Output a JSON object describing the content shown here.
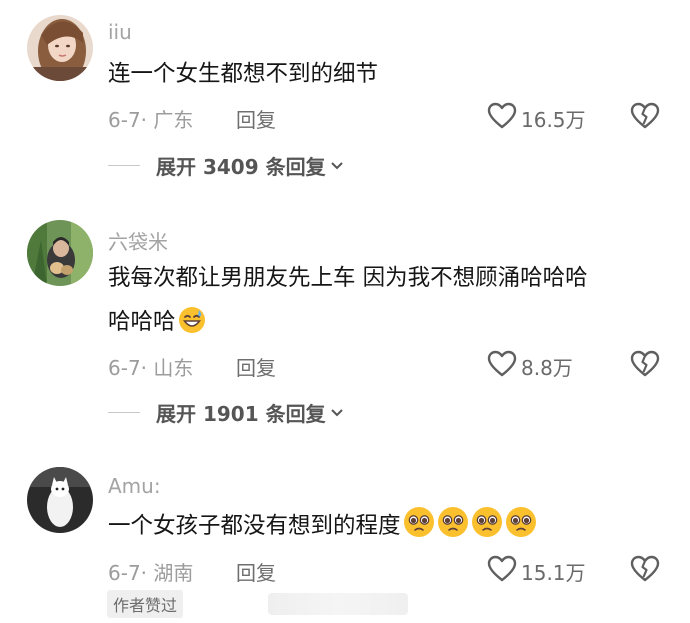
{
  "comments": [
    {
      "username": "iiu",
      "text_lines": [
        "连一个女生都想不到的细节"
      ],
      "date_location": "6-7· 广东",
      "reply_label": "回复",
      "likes": "16.5万",
      "expand_label": "展开 3409 条回复"
    },
    {
      "username": "六袋米",
      "text_lines": [
        "我每次都让男朋友先上车 因为我不想顾涌哈哈哈",
        "哈哈哈"
      ],
      "emoji": "grinning-sweat-emoji",
      "date_location": "6-7· 山东",
      "reply_label": "回复",
      "likes": "8.8万",
      "expand_label": "展开 1901 条回复"
    },
    {
      "username": "Amu:",
      "text_lines": [
        "一个女孩子都没有想到的程度"
      ],
      "emoji": "pleading-face-emoji",
      "emoji_count": 4,
      "date_location": "6-7· 湖南",
      "reply_label": "回复",
      "likes": "15.1万",
      "badge": "作者赞过"
    }
  ],
  "icons": {
    "like": "heart-outline-icon",
    "dislike": "broken-heart-icon",
    "expand": "chevron-down-icon"
  },
  "colors": {
    "text": "#161616",
    "meta": "#9c9c9c",
    "username": "#a3a3a3",
    "emoji": "#fbc02d"
  }
}
